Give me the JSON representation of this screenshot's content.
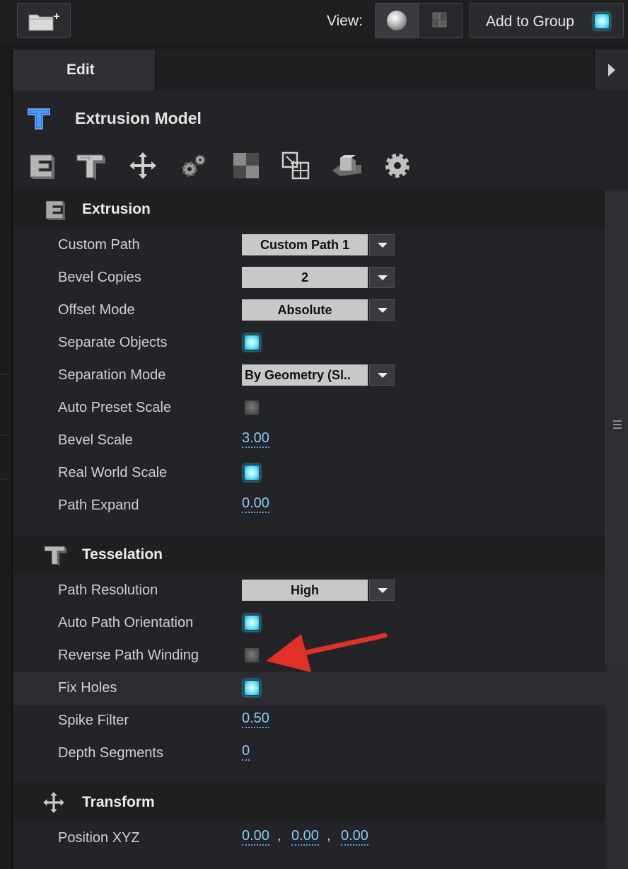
{
  "toolbar_top": {
    "view_label": "View:",
    "add_to_group_label": "Add to Group",
    "add_to_group_checked": true
  },
  "panel": {
    "tab_label": "Edit",
    "model_title": "Extrusion Model",
    "tool_icons": [
      "extrusion-icon",
      "tesselation-icon",
      "transform-move-icon",
      "gears-icon",
      "material-checker-icon",
      "layers-icon",
      "object-box-icon",
      "settings-gear-icon"
    ]
  },
  "extrusion": {
    "title": "Extrusion",
    "custom_path": {
      "label": "Custom Path",
      "value": "Custom Path 1"
    },
    "bevel_copies": {
      "label": "Bevel Copies",
      "value": "2"
    },
    "offset_mode": {
      "label": "Offset Mode",
      "value": "Absolute"
    },
    "separate_objects": {
      "label": "Separate Objects",
      "checked": true
    },
    "separation_mode": {
      "label": "Separation Mode",
      "value": "By Geometry (Sl.."
    },
    "auto_preset_scale": {
      "label": "Auto Preset Scale",
      "checked": false
    },
    "bevel_scale": {
      "label": "Bevel Scale",
      "value": "3.00"
    },
    "real_world_scale": {
      "label": "Real World Scale",
      "checked": true
    },
    "path_expand": {
      "label": "Path Expand",
      "value": "0.00"
    }
  },
  "tesselation": {
    "title": "Tesselation",
    "path_resolution": {
      "label": "Path Resolution",
      "value": "High"
    },
    "auto_path_orientation": {
      "label": "Auto Path Orientation",
      "checked": true
    },
    "reverse_path_winding": {
      "label": "Reverse Path Winding",
      "checked": false
    },
    "fix_holes": {
      "label": "Fix Holes",
      "checked": true
    },
    "spike_filter": {
      "label": "Spike Filter",
      "value": "0.50"
    },
    "depth_segments": {
      "label": "Depth Segments",
      "value": "0"
    }
  },
  "transform": {
    "title": "Transform",
    "position_xyz": {
      "label": "Position XYZ",
      "x": "0.00",
      "y": "0.00",
      "z": "0.00",
      "separator": ","
    }
  },
  "colors": {
    "accent_checkbox": "#4fd5f2",
    "numeric_value": "#8ecbf5",
    "annotation_arrow": "#e0302a"
  }
}
